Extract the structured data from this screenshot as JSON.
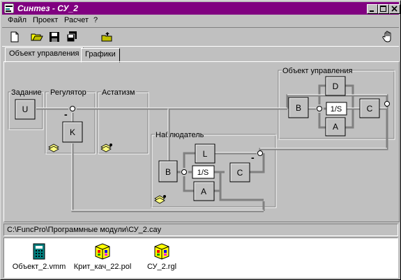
{
  "window": {
    "title": "Синтез - СУ_2"
  },
  "menu": {
    "items": [
      "Файл",
      "Проект",
      "Расчет",
      "?"
    ]
  },
  "tabs": [
    "Объект управления",
    "Графики"
  ],
  "diagram": {
    "groups": {
      "task": "Задание",
      "regulator": "Регулятор",
      "astatism": "Астатизм",
      "observer": "Наблюдатель",
      "plant": "Объект управления"
    },
    "blocks": {
      "u": "U",
      "k": "K",
      "plant_b": "B",
      "plant_d": "D",
      "plant_int": "1/S",
      "plant_c": "C",
      "plant_a": "A",
      "obs_b": "B",
      "obs_l": "L",
      "obs_int": "1/S",
      "obs_c": "C",
      "obs_a": "A"
    },
    "signs": {
      "regulator_minus": "-",
      "observer_minus": "-"
    }
  },
  "path": "C:\\FuncPro\\Программные модули\\СУ_2.cay",
  "files": [
    {
      "name": "Объект_2.vmm",
      "icon": "vmm-file-icon"
    },
    {
      "name": "Крит_кач_22.pol",
      "icon": "pol-file-icon"
    },
    {
      "name": "СУ_2.rgl",
      "icon": "rgl-file-icon"
    }
  ]
}
